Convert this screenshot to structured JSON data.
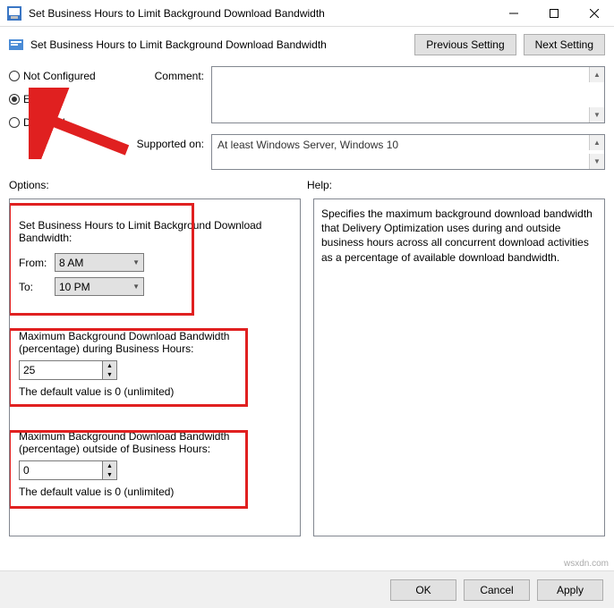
{
  "titlebar": {
    "title": "Set Business Hours to Limit Background Download Bandwidth"
  },
  "header": {
    "title": "Set Business Hours to Limit Background Download Bandwidth",
    "prev": "Previous Setting",
    "next": "Next Setting"
  },
  "radios": {
    "not_configured": "Not Configured",
    "enabled": "Enabled",
    "disabled": "Disabled"
  },
  "labels": {
    "comment": "Comment:",
    "supported_on": "Supported on:",
    "options": "Options:",
    "help": "Help:"
  },
  "supported_on_value": "At least Windows Server, Windows 10",
  "options": {
    "block1_title": "Set Business Hours to Limit Background Download Bandwidth:",
    "from_label": "From:",
    "from_value": "8 AM",
    "to_label": "To:",
    "to_value": "10 PM",
    "block2_title": "Maximum Background Download Bandwidth (percentage) during Business Hours:",
    "block2_value": "25",
    "block2_note": "The default value is 0 (unlimited)",
    "block3_title": "Maximum Background Download Bandwidth (percentage) outside of Business Hours:",
    "block3_value": "0",
    "block3_note": "The default value is 0 (unlimited)"
  },
  "help_text": "Specifies the maximum background download bandwidth that Delivery Optimization uses during and outside business hours across all concurrent download activities as a percentage of available download bandwidth.",
  "footer": {
    "ok": "OK",
    "cancel": "Cancel",
    "apply": "Apply"
  },
  "watermark": "wsxdn.com"
}
